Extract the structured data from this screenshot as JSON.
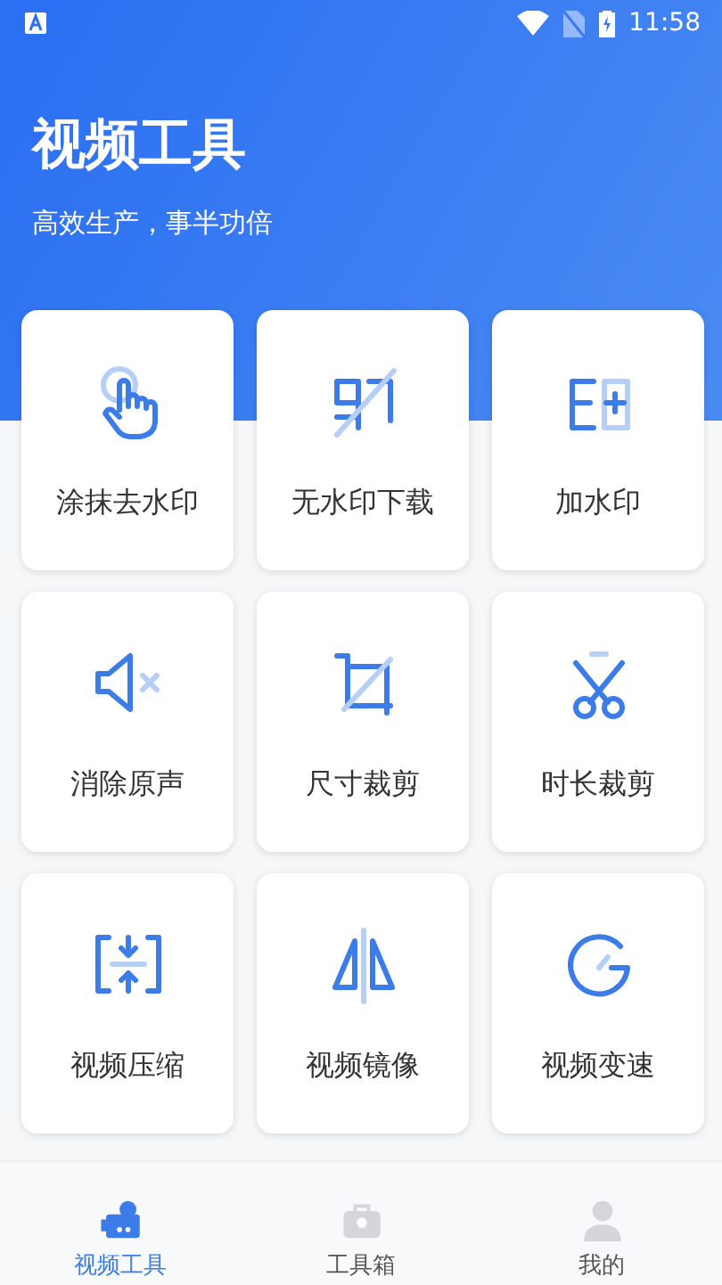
{
  "status_bar": {
    "time": "11:58"
  },
  "header": {
    "title": "视频工具",
    "subtitle": "高效生产，事半功倍"
  },
  "tools": [
    {
      "kind": "tap",
      "label": "涂抹去水印"
    },
    {
      "kind": "nomark",
      "label": "无水印下载"
    },
    {
      "kind": "addmark",
      "label": "加水印"
    },
    {
      "kind": "mute",
      "label": "消除原声"
    },
    {
      "kind": "crop",
      "label": "尺寸裁剪"
    },
    {
      "kind": "scissors",
      "label": "时长裁剪"
    },
    {
      "kind": "compress",
      "label": "视频压缩"
    },
    {
      "kind": "mirror",
      "label": "视频镜像"
    },
    {
      "kind": "speed",
      "label": "视频变速"
    }
  ],
  "tabs": [
    {
      "kind": "camera",
      "label": "视频工具",
      "selected": true
    },
    {
      "kind": "toolbox",
      "label": "工具箱",
      "selected": false
    },
    {
      "kind": "person",
      "label": "我的",
      "selected": false
    }
  ]
}
